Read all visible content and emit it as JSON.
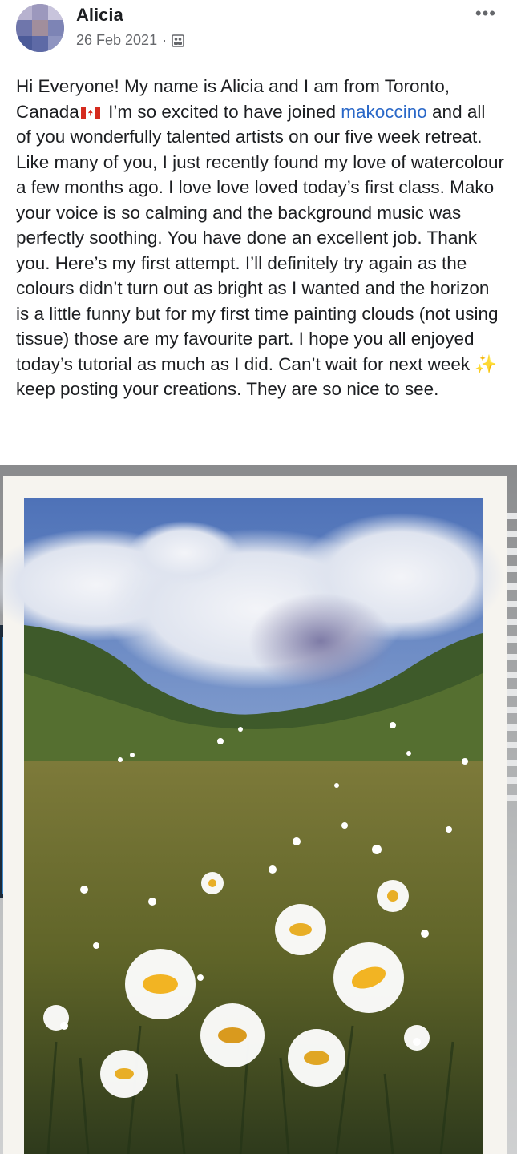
{
  "post": {
    "author": "Alicia",
    "date": "26 Feb 2021",
    "separator": "·",
    "audience_icon": "group-audience-icon",
    "more_icon": "more-options-icon",
    "more_label": "•••",
    "text_part1": "Hi Everyone! My name is Alicia and I am from Toronto, Canada",
    "flag_emoji": "canada-flag-emoji",
    "text_part2": " I’m so excited to have joined ",
    "mention": "makoccino",
    "text_part3": " and all of you wonderfully talented artists on our five week retreat. Like many of you, I just recently found my love of watercolour a few months ago. I love love loved today’s first class. Mako your voice is so calming and the background music was perfectly soothing. You have done an excellent job. Thank you. Here’s my first attempt. I’ll definitely try again as the colours didn’t turn out as bright as I wanted and the horizon is a little funny but for my first time painting clouds (not using tissue) those are my favourite part. I hope you all enjoyed today’s tutorial as much as I did. Can’t wait for next week ",
    "sparkle": "✨",
    "text_part4": " keep posting your creations. They are so nice to see."
  },
  "photo": {
    "subject": "watercolour painting of a daisy field under a cloudy sky"
  },
  "colors": {
    "mention_link": "#2a68c8",
    "secondary_text": "#65676b",
    "primary_text": "#1c1e21"
  }
}
